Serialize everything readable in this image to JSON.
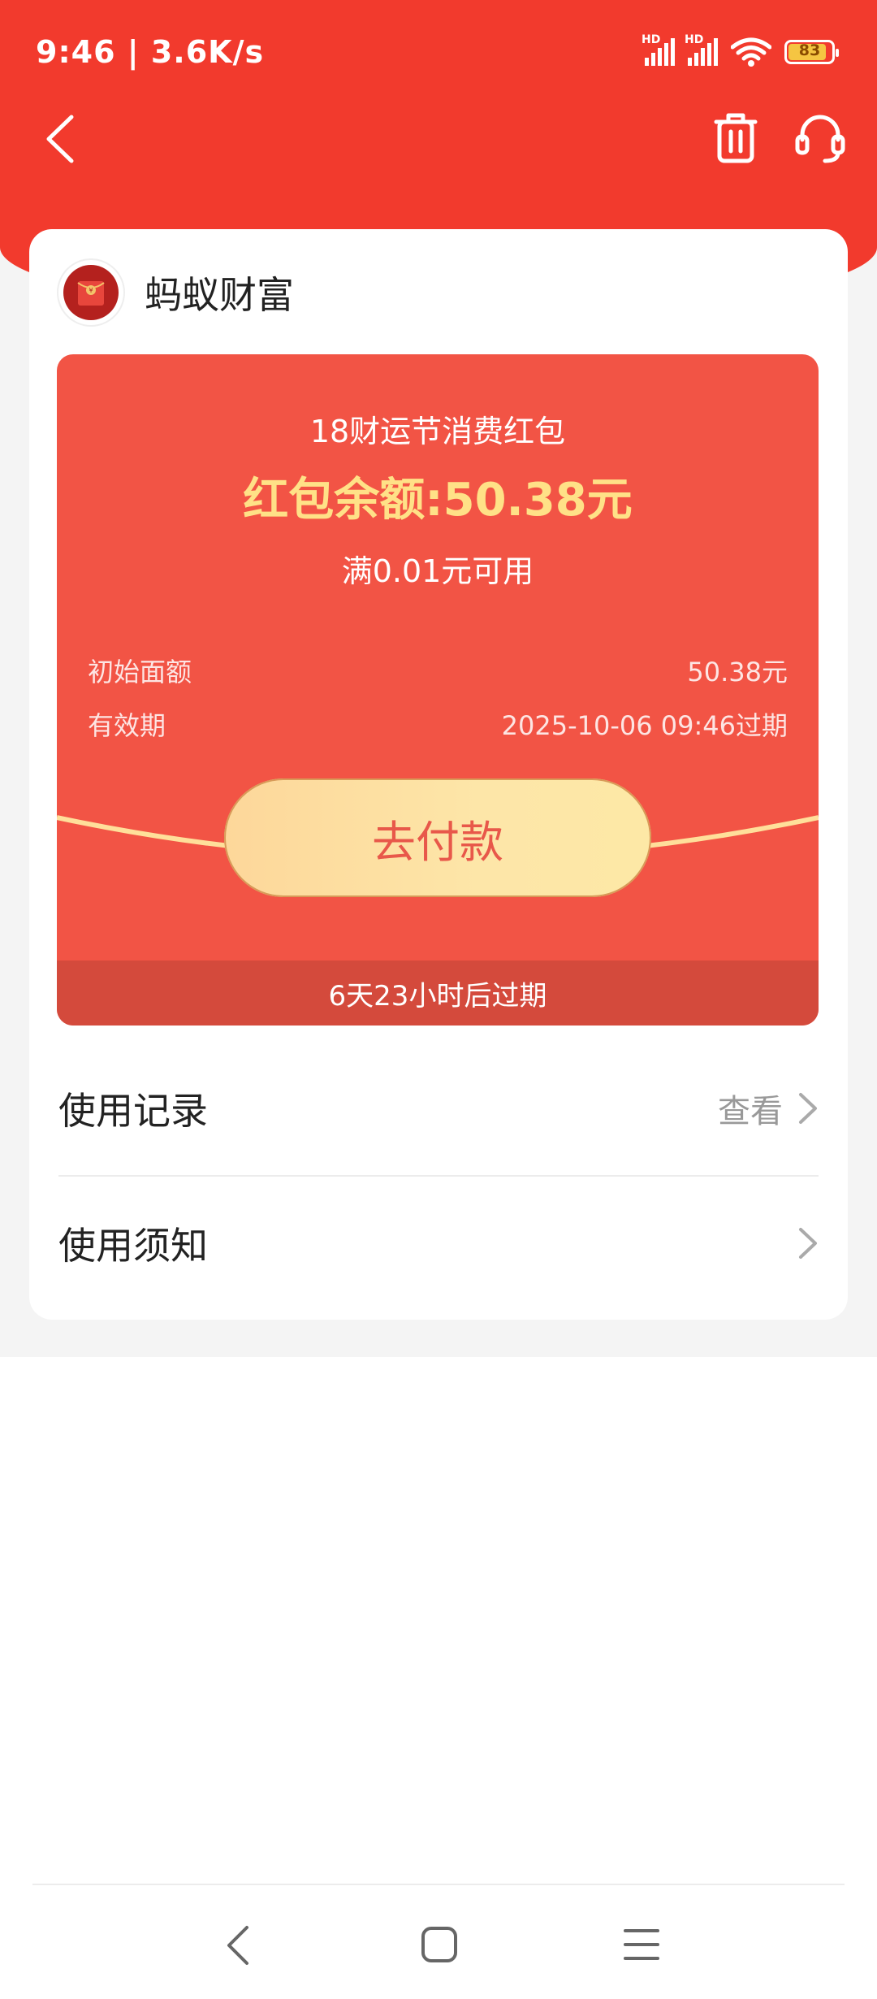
{
  "status_bar": {
    "time": "9:46 | 3.6K/s",
    "signal1_label": "HD",
    "signal2_label": "HD",
    "battery_level": "83"
  },
  "nav": {
    "back_icon": "chevron-left-icon",
    "delete_icon": "trash-icon",
    "service_icon": "headset-icon"
  },
  "brand": {
    "name": "蚂蚁财富",
    "logo_icon": "red-envelope-icon"
  },
  "red_packet": {
    "title": "18财运节消费红包",
    "balance": "红包余额:50.38元",
    "condition": "满0.01元可用",
    "initial_label": "初始面额",
    "initial_value": "50.38元",
    "validity_label": "有效期",
    "validity_value": "2025-10-06 09:46过期",
    "pay_button": "去付款",
    "expire_notice": "6天23小时后过期"
  },
  "menu": {
    "records_label": "使用记录",
    "records_view": "查看",
    "notice_label": "使用须知"
  },
  "colors": {
    "header_red": "#f23a2d",
    "packet_red": "#f25445",
    "balance_gold": "#ffe187",
    "button_gold": "#fde6a8"
  }
}
